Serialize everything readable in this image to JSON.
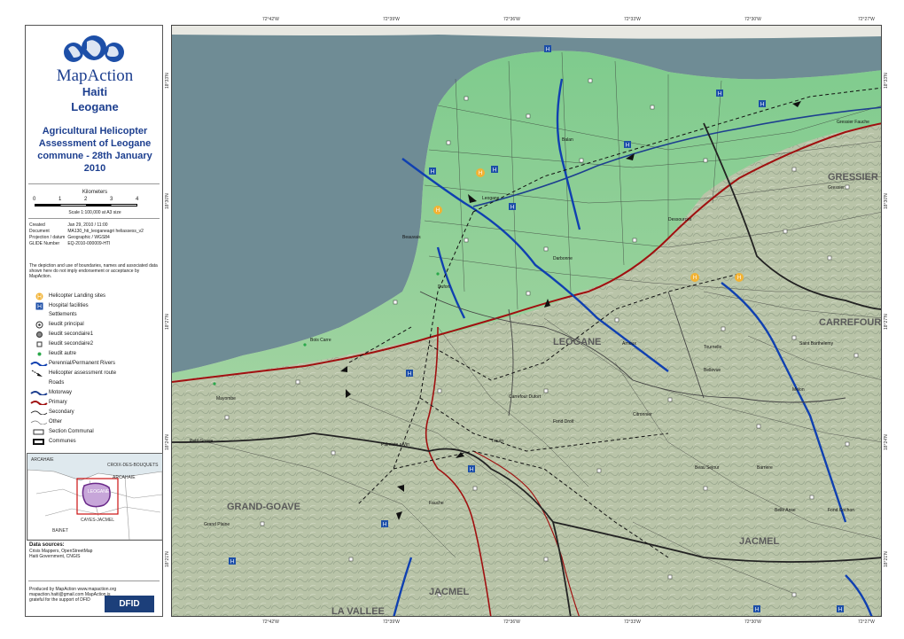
{
  "coords": {
    "top_lon": [
      "72°42'W",
      "72°39'W",
      "72°36'W",
      "72°33'W",
      "72°30'W",
      "72°27'W"
    ],
    "bottom_lon": [
      "72°42'W",
      "72°39'W",
      "72°36'W",
      "72°33'W",
      "72°30'W",
      "72°27'W"
    ],
    "left_lat": [
      "18°33'N",
      "18°30'N",
      "18°27'N",
      "18°24'N",
      "18°21'N"
    ],
    "right_lat": [
      "18°33'N",
      "18°30'N",
      "18°27'N",
      "18°24'N",
      "18°21'N"
    ]
  },
  "panel": {
    "brand": "MapAction",
    "country": "Haiti",
    "place": "Leogane",
    "title": "Agricultural Helicopter Assessment of Leogane commune - 28th January 2010",
    "scale_title": "Kilometers",
    "scale_ticks": [
      "0",
      "1",
      "2",
      "3",
      "4"
    ],
    "scale_note": "Scale 1:100,000 at A3 size",
    "meta": [
      {
        "k": "Created",
        "v": "Jan 29, 2010 / 11:00"
      },
      {
        "k": "Document",
        "v": "MA130_hti_leoganeagri heliassess_v2"
      },
      {
        "k": "Projection / datum",
        "v": "Geographic / WGS84"
      },
      {
        "k": "GLIDE Number",
        "v": "EQ-2010-000009-HTI"
      }
    ],
    "disclaimer": "The depiction and use of boundaries, names and associated data shown here do not imply endorsement or acceptance by MapAction.",
    "legend": {
      "landing": "Helicopter Landing sites",
      "hospital": "Hospital facilities",
      "settlements_title": "Settlements",
      "lieudit_principal": "lieudit principal",
      "lieudit_sec1": "lieudit secondaire1",
      "lieudit_sec2": "lieudit secondaire2",
      "lieudit_autre": "lieudit autre",
      "rivers": "Perennial/Permanent Rivers",
      "heli_route": "Helicopter assessment route",
      "roads_title": "Roads",
      "motorway": "Motorway",
      "primary": "Primary",
      "secondary": "Secondary",
      "other": "Other",
      "section": "Section Communal",
      "communes": "Communes"
    },
    "inset_labels": [
      "ARCAHAIE",
      "ARCAHAIE",
      "CAYES-JACMEL",
      "BAINET",
      "LEOGANE",
      "CROIX-DES-BOUQUETS"
    ],
    "sources_title": "Data sources:",
    "sources": "Crisis Mappers, OpenStreetMap\nHaiti Government, CNGIS",
    "produced": "Produced by MapAction www.mapaction.org mapaction.haiti@gmail.com MapAction is grateful for the support of DFID",
    "dfid": "DFID"
  },
  "map": {
    "region_labels": [
      {
        "text": "LEOGANE",
        "kind": "commune"
      },
      {
        "text": "GRAND-GOAVE",
        "kind": "commune"
      },
      {
        "text": "JACMEL",
        "kind": "commune"
      },
      {
        "text": "JACMEL",
        "kind": "commune"
      },
      {
        "text": "CARREFOUR",
        "kind": "commune"
      },
      {
        "text": "GRESSIER",
        "kind": "commune"
      },
      {
        "text": "LA VALLEE",
        "kind": "commune"
      }
    ],
    "place_labels": [
      "Leogane",
      "Dufort",
      "Petit Goave",
      "Gressier",
      "Carrefour Dufort",
      "Darbonne",
      "Trouin",
      "Citronnier",
      "Fond Droit",
      "Beau Sejour",
      "Barriere",
      "Palmiste a Vin",
      "Mayombe",
      "Bois Carre",
      "Tournelle",
      "Arnoux",
      "Saint Barthelemy",
      "Fond Cochon",
      "Grand Plaine",
      "Belle Anse",
      "Fauche",
      "Gressier Fauche",
      "Melon",
      "Dessources",
      "Beauvais",
      "Balan",
      "Bellevue"
    ]
  },
  "colors": {
    "sea": "#6f8c95",
    "lowland": "#7dc58e",
    "highland": "#b8c3a6",
    "river": "#1040b0",
    "road_primary": "#a01010",
    "heli_route": "#111111"
  }
}
